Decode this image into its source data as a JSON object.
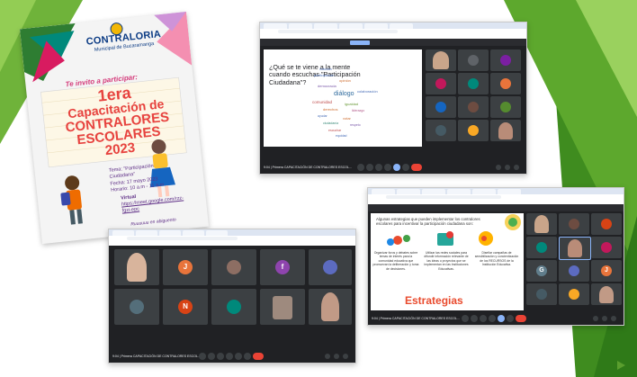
{
  "poster": {
    "logo_name": "CONTRALORIA",
    "logo_sub": "Municipal de Bucaramanga",
    "invite": "Te invito a participar:",
    "title_lines": [
      "1era",
      "Capacitación de",
      "CONTRALORES",
      "ESCOLARES",
      "2023"
    ],
    "details": [
      "Tema: \"Participación",
      "Ciudadana\"",
      "Fecha: 17 mayo 2023",
      "Horario: 10 a.m - 11 a.m"
    ],
    "virtual": [
      "Virtual",
      "https://meet.google.com/rzz-",
      "fgzi-epc"
    ],
    "footer": "Ruuuuuu en abiguento"
  },
  "meet_top": {
    "question": "¿Qué se te viene a la mente cuando escuchas \"Participación Ciudadana\"?",
    "words": [
      {
        "text": "inclusión",
        "color": "#4a6fb8"
      },
      {
        "text": "participación",
        "color": "#4a6fb8"
      },
      {
        "text": "opinión",
        "color": "#cf6d2f"
      },
      {
        "text": "democracia",
        "color": "#7a58a8"
      },
      {
        "text": "diálogo",
        "color": "#2f6b9e"
      },
      {
        "text": "colaboración",
        "color": "#4a6fb8"
      },
      {
        "text": "comunidad",
        "color": "#bf4a4a"
      },
      {
        "text": "igualdad",
        "color": "#6a9a3a"
      },
      {
        "text": "derechos",
        "color": "#cf6d2f"
      },
      {
        "text": "liderazgo",
        "color": "#b35a8a"
      },
      {
        "text": "ayudar",
        "color": "#4a6fb8"
      },
      {
        "text": "votar",
        "color": "#cf6d2f"
      },
      {
        "text": "ciudadanía",
        "color": "#3a8a7a"
      },
      {
        "text": "respeto",
        "color": "#7a58a8"
      },
      {
        "text": "escuchar",
        "color": "#bf4a4a"
      },
      {
        "text": "equidad",
        "color": "#4a6fb8"
      }
    ],
    "meeting_name": "9:04 | Primera CAPACITACIÓN DE CONTRALORES ESCOL..."
  },
  "meet_left": {
    "avatars": [
      {
        "letter": "J",
        "color": "#e8743b"
      },
      {
        "letter": "f",
        "color": "#8e44ad"
      },
      {
        "letter": "N",
        "color": "#d84315"
      }
    ],
    "meeting_name": "9:04 | Primera CAPACITACIÓN DE CONTRALORES ESCOL..."
  },
  "meet_right": {
    "headline": "Algunas estrategias que pueden implementar los contralores escolares para incentivar la participación ciudadana son:",
    "strategies": [
      "Organizar foros y debates sobre temas de interés para la comunidad educativa que promuevan la deliberación y toma de decisiones.",
      "Utilizar las redes sociales para difundir información relevante de las ideas o proyectos que se implementan en las Instituciones Educativas.",
      "Diseñar campañas de sensibilización y concientización de los RECURSOS de la Institución Educativa."
    ],
    "title": "Estrategias",
    "avatars": [
      {
        "letter": "G",
        "color": "#607d8b"
      },
      {
        "letter": "J",
        "color": "#e8743b"
      }
    ],
    "meeting_name": "9:04 | Primera CAPACITACIÓN DE CONTRALORES ESCOL..."
  },
  "colors": {
    "green_dark": "#4c9a2a",
    "green_light": "#8bc34a",
    "meet_bg": "#202124",
    "tile_bg": "#3c4043",
    "end_call": "#ea4335"
  }
}
